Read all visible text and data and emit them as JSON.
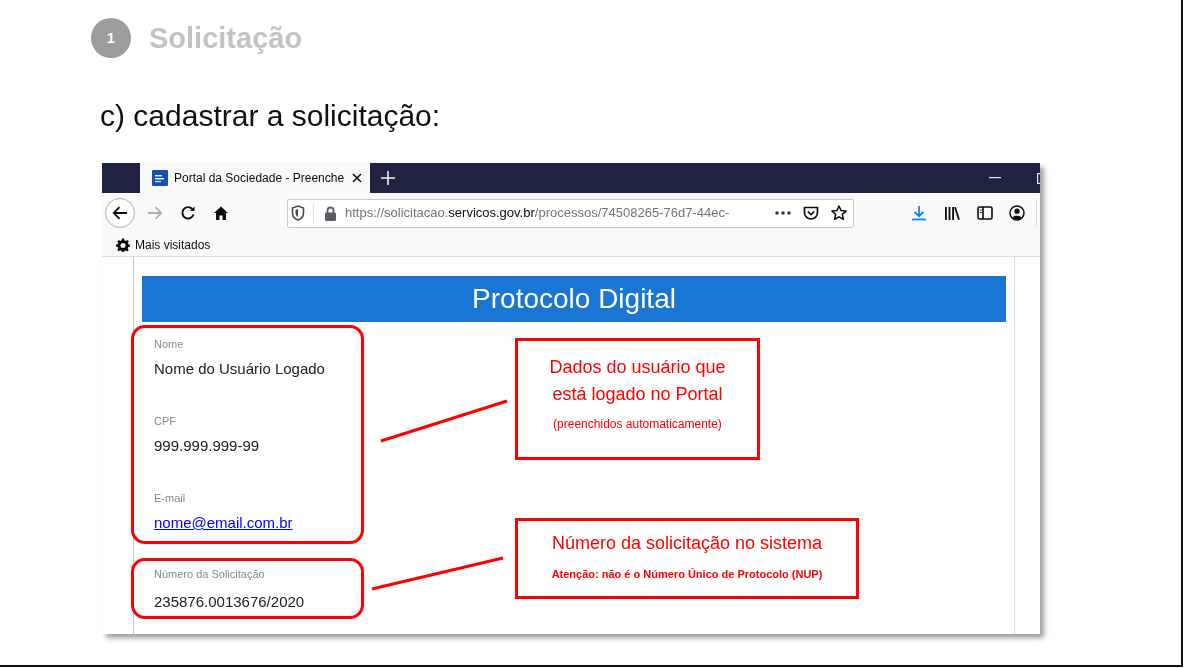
{
  "slide": {
    "step_number": "1",
    "step_title": "Solicitação",
    "instruction": "c) cadastrar a solicitação:"
  },
  "browser": {
    "tabs": [
      {
        "title": "Portal da Sociedade - Preenche",
        "selected": true
      }
    ],
    "url": {
      "scheme_and_subdomain": "https://solicitacao.",
      "domain": "servicos.gov.br",
      "path": "/processos/74508265-76d7-44ec-"
    },
    "bookmarks": [
      {
        "label": "Mais visitados"
      }
    ]
  },
  "page": {
    "title": "Protocolo Digital",
    "groups": [
      {
        "fields": [
          {
            "label": "Nome",
            "value": "Nome do Usuário Logado",
            "kind": "text"
          },
          {
            "label": "CPF",
            "value": "999.999.999-99",
            "kind": "text"
          },
          {
            "label": "E-mail",
            "value": "nome@email.com.br",
            "kind": "link"
          }
        ],
        "callout": {
          "kind": "hint",
          "title": "Dados do usuário que está logado no Portal",
          "note": "(preenchidos automaticamente)"
        }
      },
      {
        "fields": [
          {
            "label": "Número da Solicitação",
            "value": "235876.0013676/2020",
            "kind": "text"
          }
        ],
        "callout": {
          "kind": "warning",
          "title": "Número da solicitação no sistema",
          "note": "Atenção: não é o Número Único de Protocolo (NUP)"
        }
      }
    ]
  }
}
